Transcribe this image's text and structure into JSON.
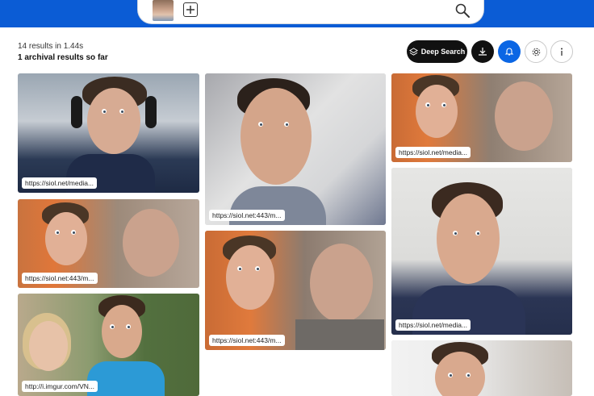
{
  "header": {
    "search_placeholder": "",
    "query_image": "face-thumbnail"
  },
  "stats": {
    "results_line": "14 results in 1.44s",
    "archival_line": "1 archival results so far"
  },
  "toolbar": {
    "deep_search_label": "Deep Search",
    "icons": [
      "layers-icon",
      "download-icon",
      "bell-icon",
      "gear-icon",
      "info-icon"
    ]
  },
  "results": [
    {
      "url": "https://siol.net/media..."
    },
    {
      "url": "https://siol.net:443/m..."
    },
    {
      "url": "http://i.imgur.com/VN..."
    },
    {
      "url": "https://siol.net:443/m..."
    },
    {
      "url": "https://siol.net:443/m..."
    },
    {
      "url": "https://siol.net/media..."
    },
    {
      "url": "https://siol.net/media..."
    },
    {
      "url": ""
    }
  ],
  "colors": {
    "brand": "#0b5cd5",
    "bell_button": "#0b66e4",
    "dark_button": "#111111"
  }
}
